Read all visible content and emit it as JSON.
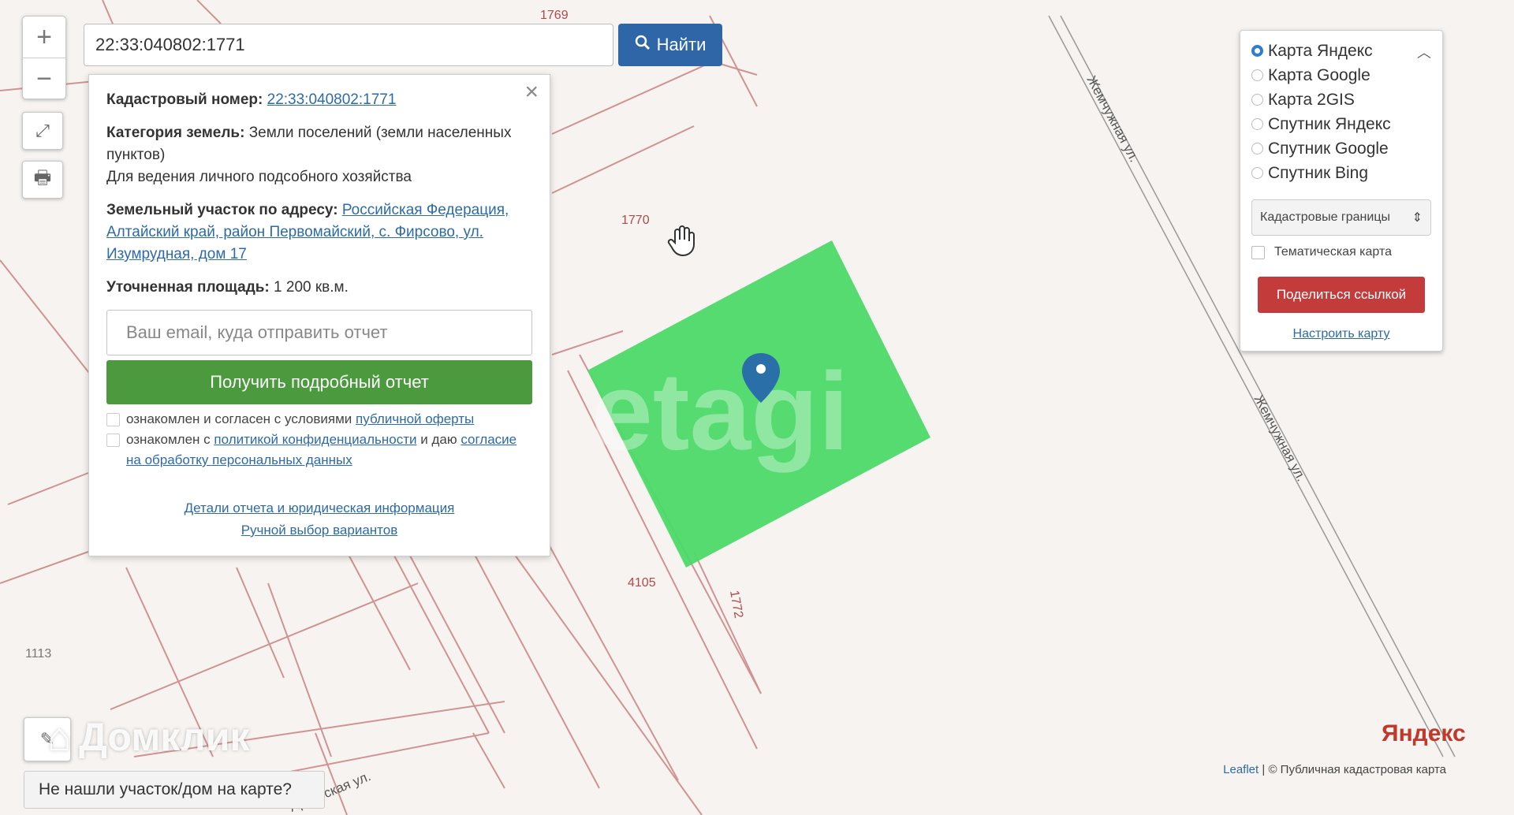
{
  "search": {
    "value": "22:33:040802:1771",
    "button_label": "Найти"
  },
  "map": {
    "labels": [
      "1769",
      "1770",
      "4105",
      "1772",
      "1113"
    ],
    "street_labels": [
      "Жемчужная ул.",
      "Жемчужная ул.",
      "Арбатская ул."
    ]
  },
  "popup": {
    "cadastral_label": "Кадастровый номер:",
    "cadastral_value": "22:33:040802:1771",
    "category_label": "Категория земель:",
    "category_value": "Земли поселений (земли населенных пунктов)",
    "usage": "Для ведения личного подсобного хозяйства",
    "address_label": "Земельный участок по адресу:",
    "address_value": "Российская Федерация, Алтайский край, район Первомайский, с. Фирсово, ул. Изумрудная, дом 17",
    "area_label": "Уточненная площадь:",
    "area_value": "1 200 кв.м.",
    "email_placeholder": "Ваш email, куда отправить отчет",
    "report_button": "Получить подробный отчет",
    "consent1_text": "ознакомлен и согласен с условиями",
    "consent1_link": "публичной оферты",
    "consent2_text": "ознакомлен с",
    "consent2_link": "политикой конфиденциальности",
    "consent2_mid": "и даю",
    "consent2_link2": "согласие на обработку персональных данных",
    "details_link": "Детали отчета и юридическая информация",
    "manual_link": "Ручной выбор вариантов"
  },
  "layers": {
    "options": [
      {
        "label": "Карта Яндекс",
        "selected": true
      },
      {
        "label": "Карта Google",
        "selected": false
      },
      {
        "label": "Карта 2GIS",
        "selected": false
      },
      {
        "label": "Спутник Яндекс",
        "selected": false
      },
      {
        "label": "Спутник Google",
        "selected": false
      },
      {
        "label": "Спутник Bing",
        "selected": false
      }
    ],
    "overlay_select": "Кадастровые границы",
    "thematic_label": "Тематическая карта",
    "share_button": "Поделиться ссылкой",
    "configure_link": "Настроить карту"
  },
  "help_button": "Не нашли участок/дом на карте?",
  "watermark": "Домклик",
  "watermark_center": "etagi",
  "yandex_logo": "Яндекс",
  "attribution": {
    "leaflet": "Leaflet",
    "copyright": "© Публичная кадастровая карта"
  },
  "colors": {
    "parcel": "#4cd968",
    "cadastral_line": "#c07070",
    "find_button": "#2f66a8",
    "report_button": "#4c9a3e",
    "share_button": "#c33b3a"
  }
}
